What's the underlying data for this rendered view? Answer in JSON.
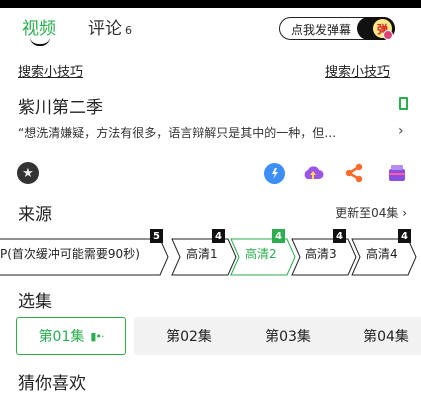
{
  "tabs": {
    "video": "视频",
    "comments": "评论",
    "comments_count": "6"
  },
  "danmu": {
    "label": "点我发弹幕",
    "toggle_glyph": "弹"
  },
  "search_tips": {
    "left": "搜索小技巧",
    "right": "搜索小技巧"
  },
  "show": {
    "title": "紫川第二季",
    "description": "“想洗清嫌疑，方法有很多，语言辩解只是其中的一种，但…",
    "more_arrow": "›"
  },
  "actions": {
    "icons": [
      "star-badge-icon",
      "chat-bubble-icon",
      "cloud-upload-icon",
      "share-icon",
      "bag-icon"
    ],
    "colors": {
      "chat": "#3d8ef7",
      "cloud": "#9b56e8",
      "share": "#ff6a2a",
      "bag": "#8a4fe0"
    }
  },
  "source": {
    "title": "来源",
    "update": "更新至04集 ›",
    "qualities": [
      {
        "label": "P(首次缓冲可能需要90秒)",
        "badge": "5",
        "selected": false
      },
      {
        "label": "高清1",
        "badge": "4",
        "selected": false
      },
      {
        "label": "高清2",
        "badge": "4",
        "selected": true
      },
      {
        "label": "高清3",
        "badge": "4",
        "selected": false
      },
      {
        "label": "高清4",
        "badge": "4",
        "selected": false
      }
    ]
  },
  "episodes": {
    "title": "选集",
    "items": [
      {
        "label": "第01集",
        "selected": true
      },
      {
        "label": "第02集",
        "selected": false
      },
      {
        "label": "第03集",
        "selected": false
      },
      {
        "label": "第04集",
        "selected": false
      }
    ]
  },
  "guess": {
    "title": "猜你喜欢"
  },
  "colors": {
    "accent": "#2aae4e",
    "text": "#222222",
    "chip_bg": "#f2f2f2"
  }
}
